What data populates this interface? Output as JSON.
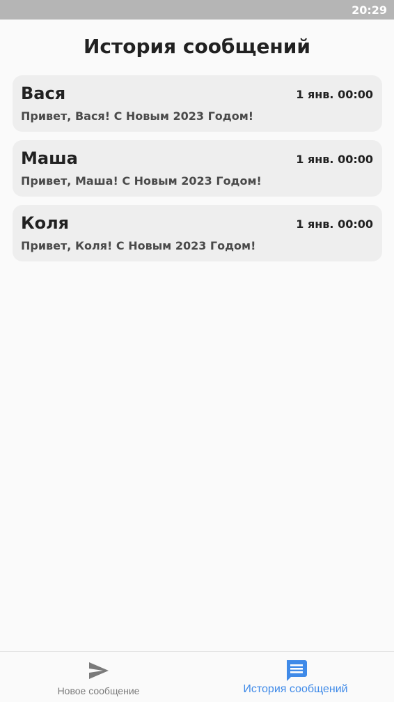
{
  "status_bar": {
    "time": "20:29"
  },
  "header": {
    "title": "История сообщений"
  },
  "messages": [
    {
      "name": "Вася",
      "time": "1 янв. 00:00",
      "text": "Привет, Вася! С Новым 2023 Годом!"
    },
    {
      "name": "Маша",
      "time": "1 янв. 00:00",
      "text": "Привет, Маша! С Новым 2023 Годом!"
    },
    {
      "name": "Коля",
      "time": "1 янв. 00:00",
      "text": "Привет, Коля! С Новым 2023 Годом!"
    }
  ],
  "bottom_nav": {
    "items": [
      {
        "label": "Новое сообщение",
        "icon": "send-icon",
        "active": false
      },
      {
        "label": "История сообщений",
        "icon": "message-icon",
        "active": true
      }
    ]
  },
  "colors": {
    "active": "#3f8ae8",
    "inactive": "#7a7a7a",
    "card_background": "#eeeeee",
    "status_bar": "#b5b5b5"
  }
}
